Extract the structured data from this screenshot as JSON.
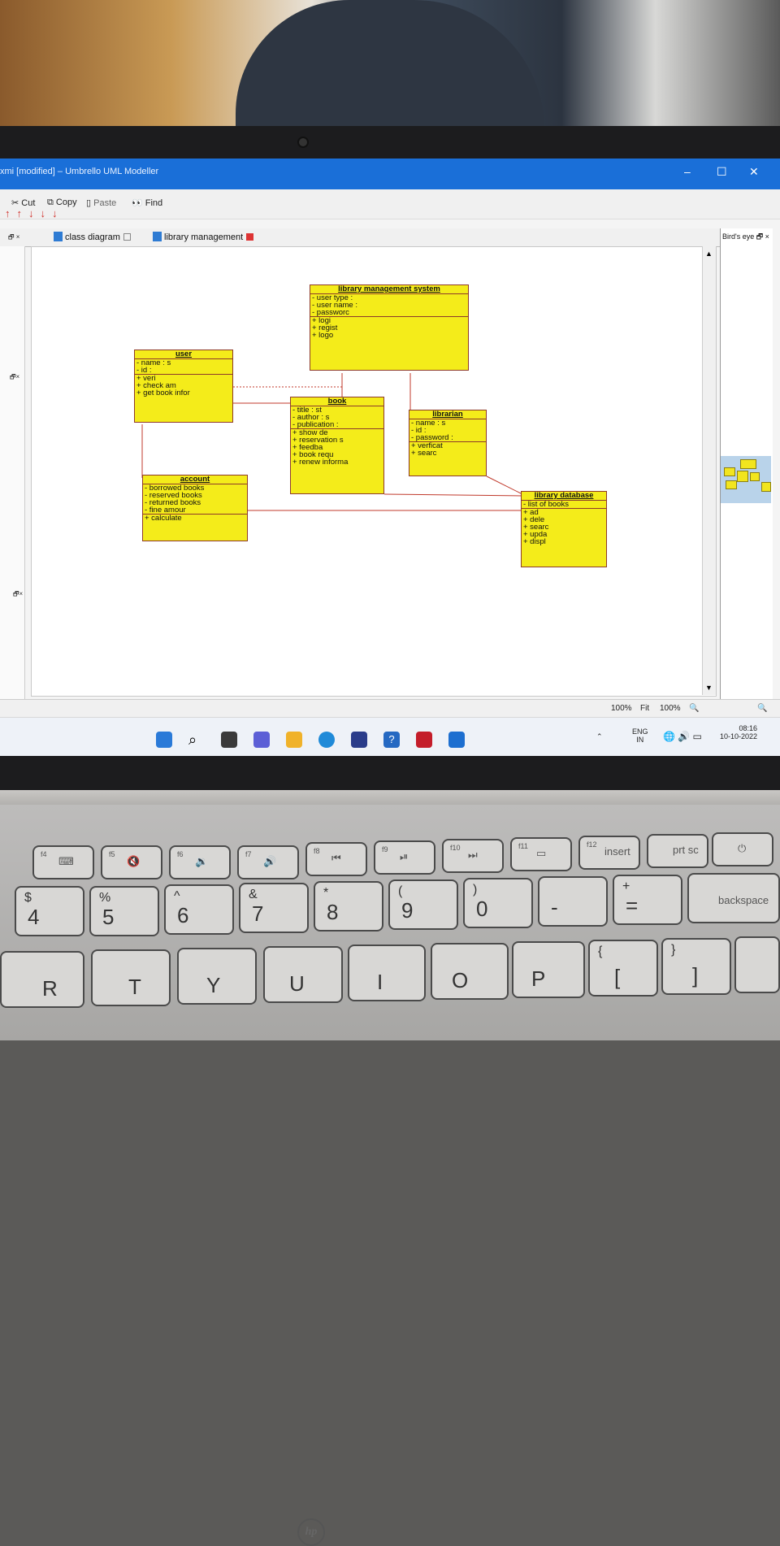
{
  "window": {
    "title": "xmi [modified] – Umbrello UML Modeller",
    "controls": {
      "minimize": "–",
      "maximize": "☐",
      "close": "✕"
    }
  },
  "toolbar": {
    "cut": "Cut",
    "copy": "Copy",
    "paste": "Paste",
    "find": "Find"
  },
  "tabs": [
    {
      "label": "class diagram"
    },
    {
      "label": "library management"
    }
  ],
  "birds_eye": {
    "title": "Bird's eye"
  },
  "status": {
    "zoom_left": "100%",
    "fit": "Fit",
    "zoom_right": "100%"
  },
  "diagram": {
    "classes": [
      {
        "name": "library management system",
        "attributes": [
          "- user type :",
          "- user name :",
          "- passworc"
        ],
        "operations": [
          "+ logi",
          "+ regist",
          "+ logo"
        ]
      },
      {
        "name": "user",
        "attributes": [
          "- name : s",
          "- id :"
        ],
        "operations": [
          "+ veri",
          "+ check am",
          "+ get book infor"
        ]
      },
      {
        "name": "book",
        "attributes": [
          "- title : st",
          "- author : s",
          "- publication :"
        ],
        "operations": [
          "+ show de",
          "+ reservation s",
          "+ feedba",
          "+ book requ",
          "+ renew informa"
        ]
      },
      {
        "name": "librarian",
        "attributes": [
          "- name : s",
          "- id :",
          "- password :"
        ],
        "operations": [
          "+ verficat",
          "+ searc"
        ]
      },
      {
        "name": "account",
        "attributes": [
          "- borrowed books",
          "- reserved books",
          "- returned books",
          "- fine amour"
        ],
        "operations": [
          "+ calculate"
        ]
      },
      {
        "name": "library database",
        "attributes": [
          "- list of books"
        ],
        "operations": [
          "+ ad",
          "+ dele",
          "+ searc",
          "+ upda",
          "+ displ"
        ]
      }
    ]
  },
  "taskbar": {
    "lang": "ENG",
    "region": "IN",
    "time": "08:16",
    "date": "10-10-2022"
  },
  "hardware": {
    "brand": "hp",
    "keys_fn": [
      "f4",
      "f5",
      "f6",
      "f7",
      "f8",
      "f9",
      "f10",
      "f11",
      "f12"
    ],
    "key_labels_top": [
      "insert",
      "prt sc"
    ],
    "key_labels_num": [
      "$",
      "4",
      "%",
      "5",
      "^",
      "6",
      "&",
      "7",
      "*",
      "8",
      "(",
      "9",
      ")",
      "0",
      "-",
      "+",
      "="
    ],
    "key_backspace": "backspace",
    "key_letters": [
      "R",
      "T",
      "Y",
      "U",
      "I",
      "O",
      "P",
      "{",
      "[",
      "}",
      "]"
    ]
  },
  "colors": {
    "titlebar": "#1a6fd8",
    "class_fill": "#f4ec1a",
    "class_border": "#8d3a2a",
    "association": "#c0392b"
  }
}
